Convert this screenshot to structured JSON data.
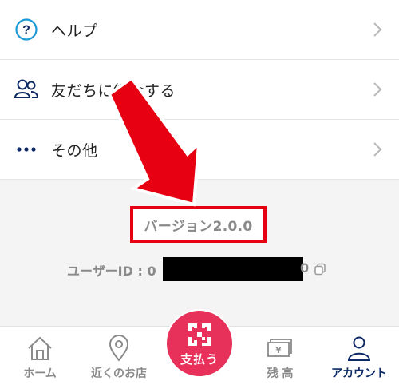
{
  "menu": {
    "items": [
      {
        "label": "ヘルプ",
        "icon": "help-circle-icon"
      },
      {
        "label": "友だちに紹介する",
        "icon": "users-icon"
      },
      {
        "label": "その他",
        "icon": "more-dots-icon"
      }
    ]
  },
  "version": {
    "text": "バージョン2.0.0",
    "highlight_color": "#e60012"
  },
  "user": {
    "label": "ユーザーID : 0",
    "id_tail": "0",
    "copy_icon": "copy-icon"
  },
  "tabbar": {
    "tabs": [
      {
        "label": "ホーム",
        "icon": "home-icon"
      },
      {
        "label": "近くのお店",
        "icon": "map-pin-icon"
      },
      {
        "label": "支払う",
        "icon": "qr-code-icon"
      },
      {
        "label": "残 高",
        "icon": "banknote-icon"
      },
      {
        "label": "アカウント",
        "icon": "person-icon"
      }
    ],
    "active": "アカウント",
    "active_color": "#0d2a66",
    "pay_color": "#e8315a"
  },
  "annotation": {
    "arrow_color": "#e60012"
  }
}
